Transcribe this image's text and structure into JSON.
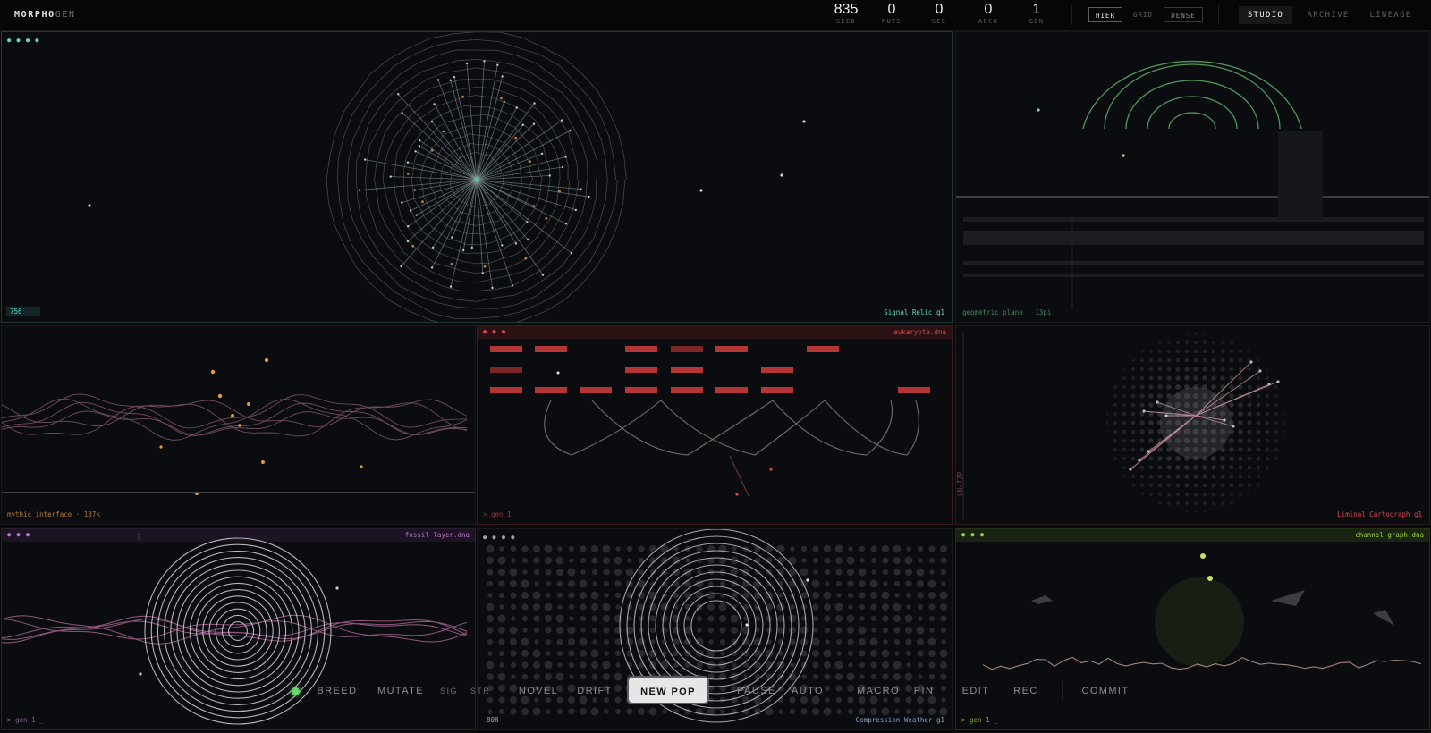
{
  "app": {
    "name_a": "MORPHO",
    "name_b": "GEN"
  },
  "stats": [
    {
      "value": "835",
      "label": "SEED"
    },
    {
      "value": "0",
      "label": "MUTS"
    },
    {
      "value": "0",
      "label": "SEL"
    },
    {
      "value": "0",
      "label": "ARCH"
    },
    {
      "value": "1",
      "label": "GEN"
    }
  ],
  "layout_modes": [
    "HIER",
    "GRID",
    "DENSE"
  ],
  "nav": [
    "STUDIO",
    "ARCHIVE",
    "LINEAGE"
  ],
  "panels": {
    "main": {
      "title": "Signal Relic g1",
      "counter": "756",
      "dots": "● ● ● ●"
    },
    "geo": {
      "title": "geometric plane · 13pi"
    },
    "mythic": {
      "title": "mythic interface · 137k"
    },
    "euk": {
      "title": "eukaryote.dna",
      "footer": "> gen 1",
      "dots": "● ● ●"
    },
    "liminal": {
      "title": "Liminal Cartograph g1",
      "side": "LN-77P"
    },
    "fossil": {
      "title": "fossil layer.dna",
      "footer": "> gen 1 _",
      "dots": "● ● ●"
    },
    "comp": {
      "title": "Compression Weather g1",
      "counter": "808",
      "dots": "● ● ● ●"
    },
    "channel": {
      "title": "channel graph.dna",
      "footer": "> gen 1 _",
      "dots": "● ● ●"
    }
  },
  "commands": {
    "breed": "BREED",
    "mutate": "MUTATE",
    "sig": "SIG",
    "str": "STR",
    "novel": "NOVEL",
    "drift": "DRIFT",
    "newpop": "NEW POP",
    "pause": "PAUSE",
    "auto": "AUTO",
    "macro": "MACRO",
    "pin": "PIN",
    "edit": "EDIT",
    "rec": "REC",
    "commit": "COMMIT"
  },
  "colors": {
    "accent_teal": "#5fd6c2",
    "accent_red": "#d9474a",
    "accent_orange": "#d88a3c",
    "accent_purple": "#b774c9",
    "accent_green": "#9bd14a",
    "status_green": "#6bd46b"
  }
}
